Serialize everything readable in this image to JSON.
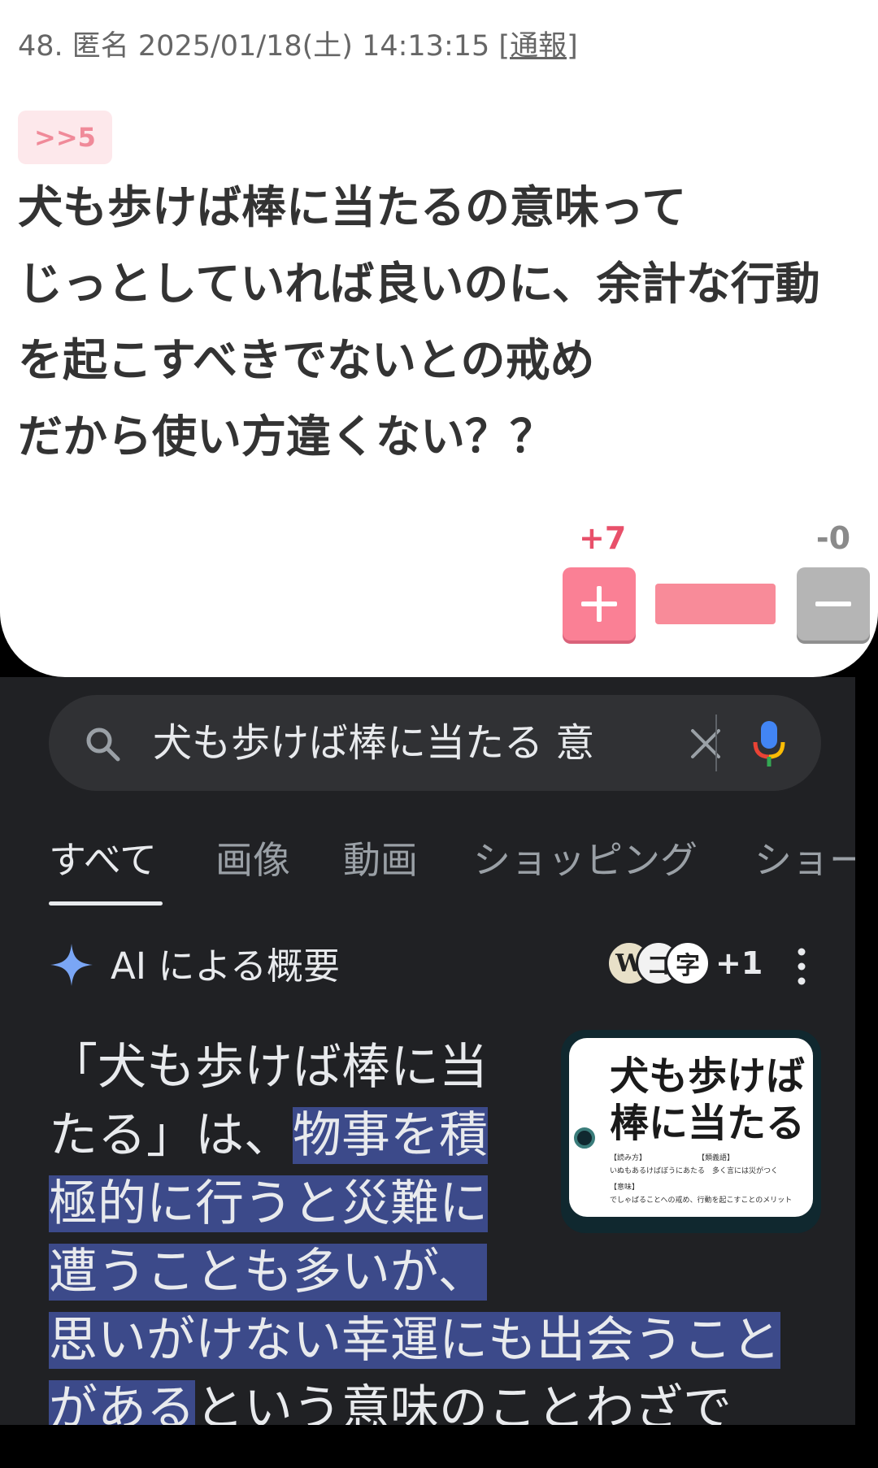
{
  "post": {
    "meta": "48. 匿名 2025/01/18(土) 14:13:15",
    "report_label": "[通報]",
    "reply_anchor": ">>5",
    "body_lines": [
      "犬も歩けば棒に当たるの意味って",
      "じっとしていれば良いのに、余計な行動",
      "を起こすべきでないとの戒め",
      "だから使い方違くない？？"
    ],
    "plus_count": "+7",
    "minus_count": "-0",
    "plus_share": 1.0,
    "colors": {
      "plus": "#fa8095",
      "minus": "#b5b5b5",
      "accent_text": "#e8506a"
    }
  },
  "search": {
    "query": "犬も歩けば棒に当たる 意",
    "icons": {
      "search": "search-icon",
      "clear": "close-icon",
      "voice": "mic-icon"
    },
    "tabs": [
      "すべて",
      "画像",
      "動画",
      "ショッピング",
      "ショー"
    ],
    "active_tab": "すべて",
    "ai_overview": {
      "title": "AI による概要",
      "source_icons": [
        "W",
        "コ",
        "字"
      ],
      "source_more": "+1",
      "text_lines": [
        [
          {
            "t": "「犬も歩けば棒に当",
            "h": false
          }
        ],
        [
          {
            "t": "たる」は、",
            "h": false
          },
          {
            "t": "物事を積",
            "h": true
          }
        ],
        [
          {
            "t": "極的に行うと災難に",
            "h": true
          }
        ],
        [
          {
            "t": "遭うことも多いが、",
            "h": true
          }
        ],
        [
          {
            "t": "思いがけない幸運にも出会うこと",
            "h": true
          }
        ],
        [
          {
            "t": "がある",
            "h": true
          },
          {
            "t": "という意味のことわざで",
            "h": false
          }
        ]
      ],
      "thumbnail": {
        "title_lines": [
          "犬も歩けば",
          "棒に当たる"
        ],
        "small_lines": [
          "【読み方】　　　　　　　　【類義語】",
          "いぬもあるけばぼうにあたる　多く言には災がつく",
          "【意味】",
          "でしゃばることへの戒め、行動を起こすことのメリット"
        ]
      },
      "highlight_color": "#3c4a8a"
    }
  }
}
